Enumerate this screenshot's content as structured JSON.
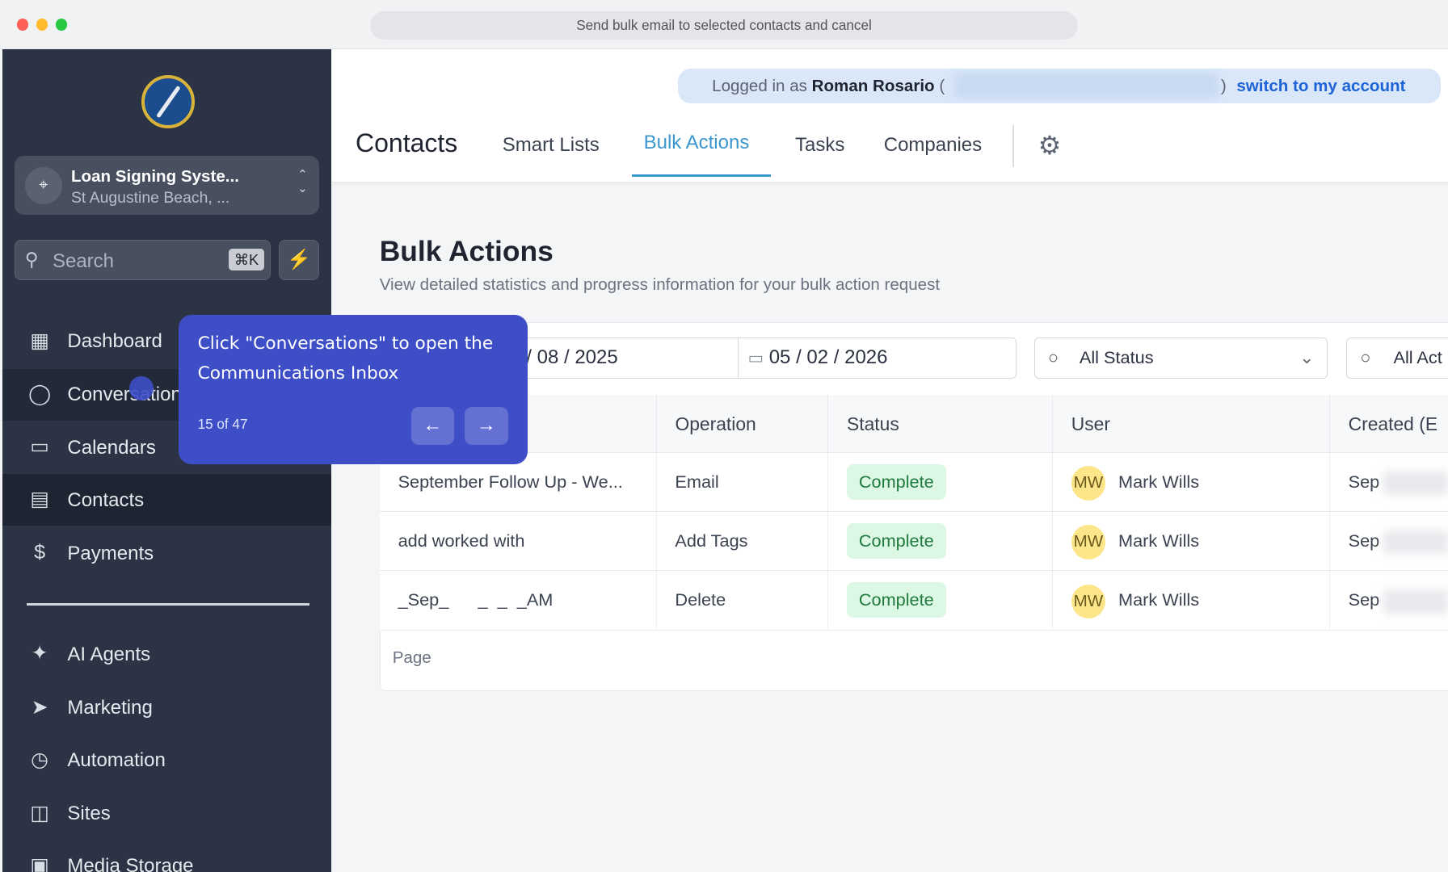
{
  "browser": {
    "url_title": "Send bulk email to selected contacts and cancel"
  },
  "sidebar": {
    "account": {
      "name": "Loan Signing Syste...",
      "location": "St Augustine Beach, ..."
    },
    "search": {
      "placeholder": "Search",
      "shortcut": "⌘K"
    },
    "items": [
      {
        "label": "Dashboard",
        "icon": "grid-icon"
      },
      {
        "label": "Conversations",
        "icon": "chat-icon"
      },
      {
        "label": "Calendars",
        "icon": "calendar-icon"
      },
      {
        "label": "Contacts",
        "icon": "contacts-icon"
      },
      {
        "label": "Payments",
        "icon": "payments-icon"
      },
      {
        "label": "AI Agents",
        "icon": "sparkle-icon"
      },
      {
        "label": "Marketing",
        "icon": "send-icon"
      },
      {
        "label": "Automation",
        "icon": "automation-icon"
      },
      {
        "label": "Sites",
        "icon": "globe-icon"
      },
      {
        "label": "Media Storage",
        "icon": "image-icon"
      }
    ]
  },
  "header": {
    "impersonation": {
      "prefix": "Logged in as",
      "name": "Roman Rosario",
      "open": "(",
      "close": ")",
      "link": "switch to my account"
    },
    "title": "Contacts",
    "tabs": [
      "Smart Lists",
      "Bulk Actions",
      "Tasks",
      "Companies"
    ],
    "active_tab": "Bulk Actions"
  },
  "page": {
    "title": "Bulk Actions",
    "subtitle": "View detailed statistics and progress information for your bulk action request",
    "filters": {
      "start_date": "/ 08 / 2025",
      "end_date": "05 / 02 / 2026",
      "status": "All Status",
      "action": "All Act"
    },
    "table": {
      "columns": [
        "Operation",
        "Status",
        "User",
        "Created (E"
      ],
      "rows": [
        {
          "name": "September Follow Up - We...",
          "operation": "Email",
          "status": "Complete",
          "initials": "MW",
          "user": "Mark Wills",
          "created": "Sep"
        },
        {
          "name": "add worked with",
          "operation": "Add Tags",
          "status": "Complete",
          "initials": "MW",
          "user": "Mark Wills",
          "created": "Sep"
        },
        {
          "name": "_Sep_      _  _  _AM",
          "operation": "Delete",
          "status": "Complete",
          "initials": "MW",
          "user": "Mark Wills",
          "created": "Sep"
        }
      ]
    },
    "pagination": "Page"
  },
  "tooltip": {
    "text": "Click \"Conversations\" to open the Communications Inbox",
    "step": "15 of 47"
  },
  "colors": {
    "sidebar": "#2b3344",
    "accent": "#3a97cf",
    "tooltip": "#3d4ec6",
    "badge": "#dcf7e4"
  }
}
